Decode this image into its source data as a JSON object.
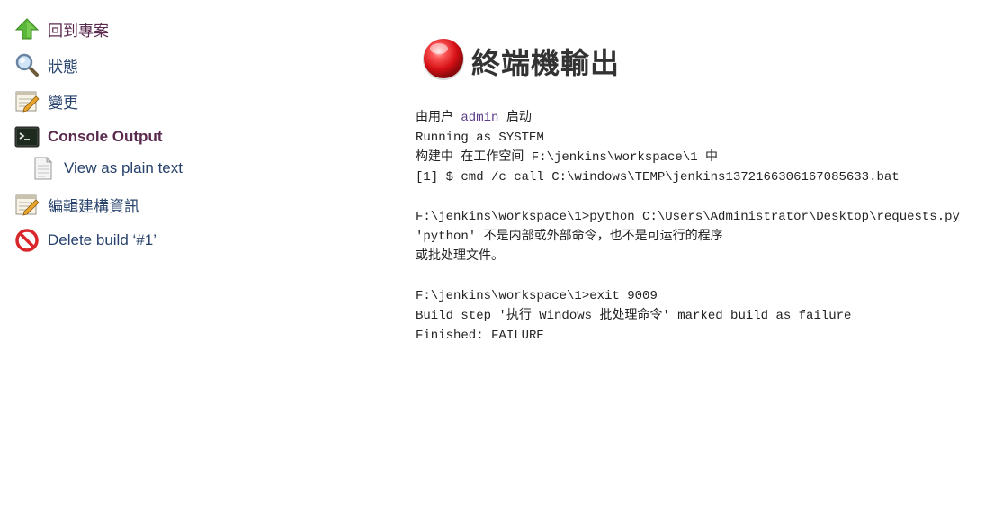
{
  "sidebar": {
    "items": [
      {
        "label": "回到專案",
        "icon": "up-arrow-icon"
      },
      {
        "label": "狀態",
        "icon": "magnifier-icon"
      },
      {
        "label": "變更",
        "icon": "notepad-icon"
      },
      {
        "label": "Console Output",
        "icon": "terminal-icon"
      },
      {
        "label": "View as plain text",
        "icon": "document-icon"
      },
      {
        "label": "編輯建構資訊",
        "icon": "notepad-icon"
      },
      {
        "label": "Delete build ‘#1’",
        "icon": "no-entry-icon"
      }
    ]
  },
  "main": {
    "title": "終端機輸出",
    "status_icon": "red-ball-icon",
    "console": {
      "started_by_prefix": "由用户 ",
      "started_by_user": "admin",
      "started_by_suffix": " 启动",
      "lines": [
        "Running as SYSTEM",
        "构建中 在工作空间 F:\\jenkins\\workspace\\1 中",
        "[1] $ cmd /c call C:\\windows\\TEMP\\jenkins1372166306167085633.bat",
        "",
        "F:\\jenkins\\workspace\\1>python C:\\Users\\Administrator\\Desktop\\requests.py",
        "'python' 不是内部或外部命令，也不是可运行的程序",
        "或批处理文件。",
        "",
        "F:\\jenkins\\workspace\\1>exit 9009",
        "Build step '执行 Windows 批处理命令' marked build as failure",
        "Finished: FAILURE"
      ]
    }
  },
  "colors": {
    "link": "#27426b",
    "visited": "#5a2a4e",
    "failure": "#e8141b"
  }
}
